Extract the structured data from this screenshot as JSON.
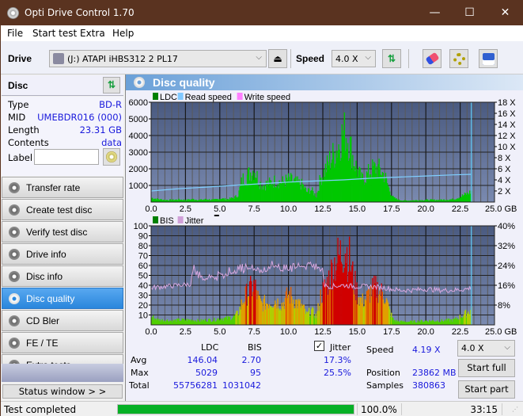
{
  "window": {
    "title": "Opti Drive Control 1.70",
    "minimize": "—",
    "maximize": "☐",
    "close": "✕"
  },
  "menu": [
    "File",
    "Start test",
    "Extra",
    "Help"
  ],
  "toolbar": {
    "drive_label": "Drive",
    "drive_value": "(J:)  ATAPI iHBS312   2 PL17",
    "speed_label": "Speed",
    "speed_value": "4.0 X"
  },
  "disc": {
    "header": "Disc",
    "fields": [
      {
        "key": "Type",
        "value": "BD-R"
      },
      {
        "key": "MID",
        "value": "UMEBDR016 (000)"
      },
      {
        "key": "Length",
        "value": "23.31 GB"
      },
      {
        "key": "Contents",
        "value": "data"
      }
    ],
    "label_key": "Label",
    "label_value": ""
  },
  "nav": [
    {
      "label": "Transfer rate",
      "active": false
    },
    {
      "label": "Create test disc",
      "active": false
    },
    {
      "label": "Verify test disc",
      "active": false
    },
    {
      "label": "Drive info",
      "active": false
    },
    {
      "label": "Disc info",
      "active": false
    },
    {
      "label": "Disc quality",
      "active": true
    },
    {
      "label": "CD Bler",
      "active": false
    },
    {
      "label": "FE / TE",
      "active": false
    },
    {
      "label": "Extra tests",
      "active": false
    }
  ],
  "status_window_btn": "Status window > >",
  "panel_title": "Disc quality",
  "chart_data": [
    {
      "type": "area",
      "title": "LDC",
      "legend": [
        "LDC",
        "Read speed",
        "Write speed"
      ],
      "legend_colors": [
        "#008000",
        "#80c8ff",
        "#ff80ff"
      ],
      "legend_position": "top-left",
      "xlabel": "GB",
      "x_ticks": [
        "0.0",
        "2.5",
        "5.0",
        "7.5",
        "10.0",
        "12.5",
        "15.0",
        "17.5",
        "20.0",
        "22.5",
        "25.0 GB"
      ],
      "y_ticks": [
        "1000",
        "2000",
        "3000",
        "4000",
        "5000",
        "6000"
      ],
      "y2_ticks": [
        "2 X",
        "4 X",
        "6 X",
        "8 X",
        "10 X",
        "12 X",
        "14 X",
        "16 X",
        "18 X"
      ],
      "xlim": [
        0,
        25
      ],
      "ylim": [
        0,
        6000
      ],
      "y2lim": [
        0,
        18
      ],
      "grid": true,
      "end_marker_x": 23.31,
      "series": [
        {
          "name": "LDC",
          "color": "#00c800",
          "x": [
            0,
            0.5,
            1,
            1.5,
            2,
            2.5,
            3,
            3.5,
            4,
            4.5,
            5,
            5.5,
            6,
            6.3,
            6.6,
            7,
            7.3,
            7.5,
            7.8,
            8,
            8.5,
            9,
            9.5,
            10,
            10.5,
            11,
            11.3,
            11.6,
            12,
            12.3,
            12.6,
            13,
            13.3,
            13.6,
            13.9,
            14.1,
            14.4,
            14.7,
            15,
            15.3,
            15.6,
            16,
            16.3,
            16.6,
            17,
            17.3,
            17.6,
            18,
            18.5,
            19,
            20,
            21,
            22,
            22.5,
            23,
            23.3
          ],
          "values": [
            300,
            200,
            150,
            150,
            180,
            150,
            200,
            150,
            200,
            150,
            250,
            200,
            300,
            500,
            1600,
            1900,
            2200,
            2300,
            1500,
            1200,
            1300,
            1500,
            1400,
            1600,
            1400,
            1200,
            700,
            900,
            400,
            1700,
            2200,
            3000,
            3400,
            4000,
            4800,
            5000,
            4200,
            3000,
            2200,
            1600,
            1800,
            2300,
            2400,
            2300,
            1800,
            900,
            300,
            150,
            100,
            120,
            150,
            150,
            200,
            400,
            600,
            750
          ]
        },
        {
          "name": "Read speed",
          "color": "#80d0ff",
          "x": [
            0,
            2,
            4,
            6,
            8,
            10,
            12,
            14,
            16,
            18,
            20,
            22,
            23.31
          ],
          "values": [
            2.0,
            2.4,
            2.7,
            3.0,
            3.3,
            3.6,
            3.8,
            4.0,
            4.3,
            4.5,
            4.7,
            4.9,
            5.0
          ]
        }
      ]
    },
    {
      "type": "bar",
      "title": "BIS",
      "legend": [
        "BIS",
        "Jitter"
      ],
      "legend_colors": [
        "#008000",
        "#d0a0d8"
      ],
      "legend_position": "top-left",
      "xlabel": "GB",
      "x_ticks": [
        "0.0",
        "2.5",
        "5.0",
        "7.5",
        "10.0",
        "12.5",
        "15.0",
        "17.5",
        "20.0",
        "22.5",
        "25.0 GB"
      ],
      "y_ticks": [
        "10",
        "20",
        "30",
        "40",
        "50",
        "60",
        "70",
        "80",
        "90",
        "100"
      ],
      "y2_ticks": [
        "8%",
        "16%",
        "24%",
        "32%",
        "40%"
      ],
      "xlim": [
        0,
        25
      ],
      "ylim": [
        0,
        100
      ],
      "y2lim": [
        0,
        40
      ],
      "grid": true,
      "end_marker_x": 23.31,
      "series": [
        {
          "name": "BIS",
          "x": [
            0,
            0.5,
            1,
            1.5,
            2,
            2.5,
            3,
            3.5,
            4,
            4.5,
            5,
            5.5,
            6,
            6.3,
            6.6,
            7,
            7.3,
            7.5,
            7.8,
            8,
            8.5,
            9,
            9.5,
            10,
            10.5,
            11,
            11.3,
            11.6,
            12,
            12.3,
            12.6,
            13,
            13.3,
            13.6,
            13.9,
            14.1,
            14.4,
            14.7,
            15,
            15.3,
            15.6,
            16,
            16.3,
            16.6,
            17,
            17.3,
            17.6,
            18,
            18.5,
            19,
            20,
            21,
            22,
            22.5,
            23,
            23.3
          ],
          "values": [
            10,
            6,
            6,
            5,
            6,
            6,
            6,
            5,
            6,
            6,
            8,
            8,
            10,
            14,
            28,
            40,
            45,
            48,
            30,
            25,
            28,
            30,
            25,
            38,
            28,
            22,
            12,
            18,
            10,
            35,
            45,
            60,
            75,
            82,
            90,
            95,
            80,
            55,
            38,
            28,
            32,
            42,
            45,
            42,
            35,
            18,
            6,
            4,
            4,
            4,
            5,
            5,
            6,
            10,
            15,
            20
          ]
        },
        {
          "name": "Jitter",
          "color": "#d8a8e0",
          "x": [
            0,
            1,
            2,
            2.9,
            3,
            4,
            5,
            5.5,
            6,
            7,
            8,
            9,
            10,
            11,
            12,
            12.5,
            12.6,
            13,
            14,
            15,
            16,
            17,
            17.5,
            18,
            19,
            20,
            21,
            22,
            23,
            23.3
          ],
          "values": [
            15,
            15.5,
            16,
            16.5,
            21,
            18,
            19,
            20,
            21,
            22,
            22,
            23,
            22,
            23,
            23,
            22,
            16,
            15.5,
            16,
            15.5,
            15.5,
            15,
            14.5,
            14,
            14,
            14.5,
            14,
            14,
            14.5,
            15
          ]
        }
      ]
    }
  ],
  "stats": {
    "col_ldc": "LDC",
    "col_bis": "BIS",
    "jitter_label": "Jitter",
    "jitter_checked": true,
    "rows": [
      {
        "label": "Avg",
        "ldc": "146.04",
        "bis": "2.70",
        "jitter": "17.3%"
      },
      {
        "label": "Max",
        "ldc": "5029",
        "bis": "95",
        "jitter": "25.5%"
      },
      {
        "label": "Total",
        "ldc": "55756281",
        "bis": "1031042",
        "jitter": ""
      }
    ],
    "speed_label": "Speed",
    "speed_value": "4.19 X",
    "position_label": "Position",
    "position_value": "23862 MB",
    "samples_label": "Samples",
    "samples_value": "380863",
    "speed_select": "4.0 X",
    "start_full": "Start full",
    "start_part": "Start part"
  },
  "statusbar": {
    "status": "Test completed",
    "progress_percent": 100.0,
    "progress_text": "100.0%",
    "time": "33:15"
  }
}
